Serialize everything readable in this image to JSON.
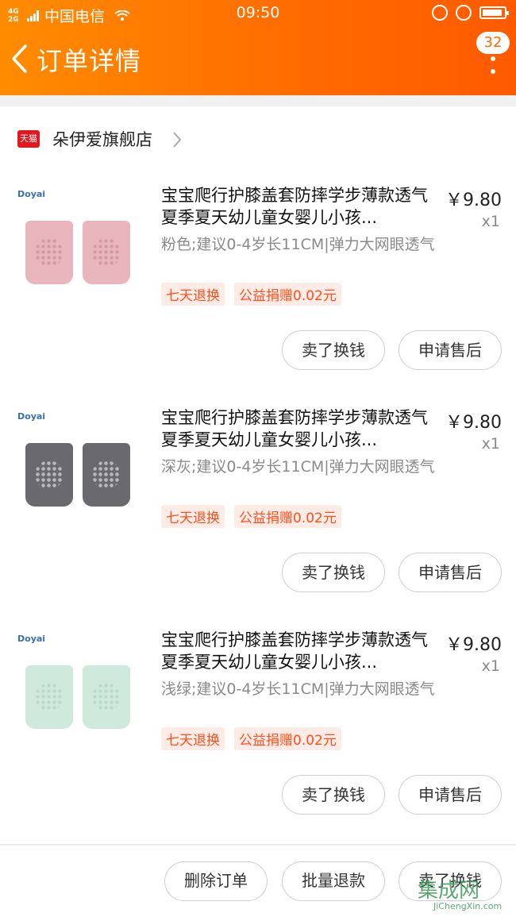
{
  "status_bar": {
    "network": "4G 2G",
    "carrier": "中国电信",
    "time": "09:50"
  },
  "nav": {
    "title": "订单详情",
    "message_count": "32"
  },
  "shop": {
    "logo_text": "天猫",
    "name": "朵伊爱旗舰店"
  },
  "items": [
    {
      "brand": "Doyai",
      "title": "宝宝爬行护膝盖套防摔学步薄款透气夏季夏天幼儿童女婴儿小孩...",
      "price": "￥9.80",
      "qty": "x1",
      "sku": "粉色;建议0-4岁长11CM|弹力大网眼透气",
      "tags": [
        "七天退换",
        "公益捐赠0.02元"
      ],
      "actions": {
        "sell": "卖了换钱",
        "after_sale": "申请售后"
      },
      "color": "#e9b6bd",
      "dot_color": "#d59aa3"
    },
    {
      "brand": "Doyai",
      "title": "宝宝爬行护膝盖套防摔学步薄款透气夏季夏天幼儿童女婴儿小孩...",
      "price": "￥9.80",
      "qty": "x1",
      "sku": "深灰;建议0-4岁长11CM|弹力大网眼透气",
      "tags": [
        "七天退换",
        "公益捐赠0.02元"
      ],
      "actions": {
        "sell": "卖了换钱",
        "after_sale": "申请售后"
      },
      "color": "#6a6a6e",
      "dot_color": "#b9b9bc"
    },
    {
      "brand": "Doyai",
      "title": "宝宝爬行护膝盖套防摔学步薄款透气夏季夏天幼儿童女婴儿小孩...",
      "price": "￥9.80",
      "qty": "x1",
      "sku": "浅绿;建议0-4岁长11CM|弹力大网眼透气",
      "tags": [
        "七天退换",
        "公益捐赠0.02元"
      ],
      "actions": {
        "sell": "卖了换钱",
        "after_sale": "申请售后"
      },
      "color": "#cfe9dd",
      "dot_color": "#b8dbcc"
    }
  ],
  "bottom_actions": {
    "delete": "删除订单",
    "batch_refund": "批量退款",
    "sell": "卖了换钱"
  },
  "watermark": {
    "main": "集成网",
    "sub": "JiChengXin.com"
  },
  "colors": {
    "accent": "#ff6a00",
    "tag_text": "#ff4f1f",
    "tag_bg": "#fdece6"
  }
}
